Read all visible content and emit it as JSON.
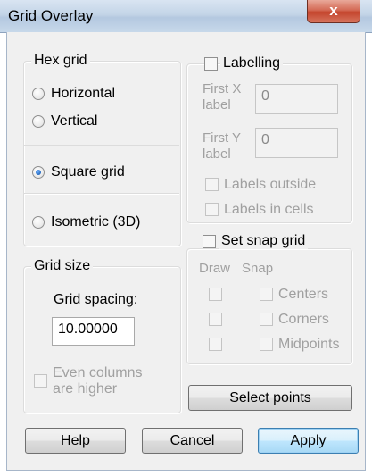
{
  "window": {
    "title": "Grid Overlay",
    "close_glyph": "x"
  },
  "hex_grid": {
    "legend": "Hex grid",
    "options": [
      {
        "label": "Horizontal",
        "checked": false
      },
      {
        "label": "Vertical",
        "checked": false
      }
    ]
  },
  "square_grid": {
    "label": "Square grid",
    "checked": true
  },
  "isometric": {
    "label": "Isometric (3D)",
    "checked": false
  },
  "grid_size": {
    "legend": "Grid size",
    "spacing_label": "Grid spacing:",
    "spacing_value": "10.00000",
    "even_columns_line1": "Even columns",
    "even_columns_line2": "are higher",
    "even_columns_checked": false
  },
  "labelling": {
    "legend": "Labelling",
    "checked": false,
    "first_x_line1": "First X",
    "first_x_line2": "label",
    "first_x_value": "0",
    "first_y_line1": "First Y",
    "first_y_line2": "label",
    "first_y_value": "0",
    "labels_outside": "Labels outside",
    "labels_in_cells": "Labels in cells"
  },
  "snap": {
    "legend": "Set snap grid",
    "checked": false,
    "draw_header": "Draw",
    "snap_header": "Snap",
    "rows": [
      "Centers",
      "Corners",
      "Midpoints"
    ]
  },
  "buttons": {
    "select_points": "Select points",
    "help": "Help",
    "cancel": "Cancel",
    "apply": "Apply"
  }
}
